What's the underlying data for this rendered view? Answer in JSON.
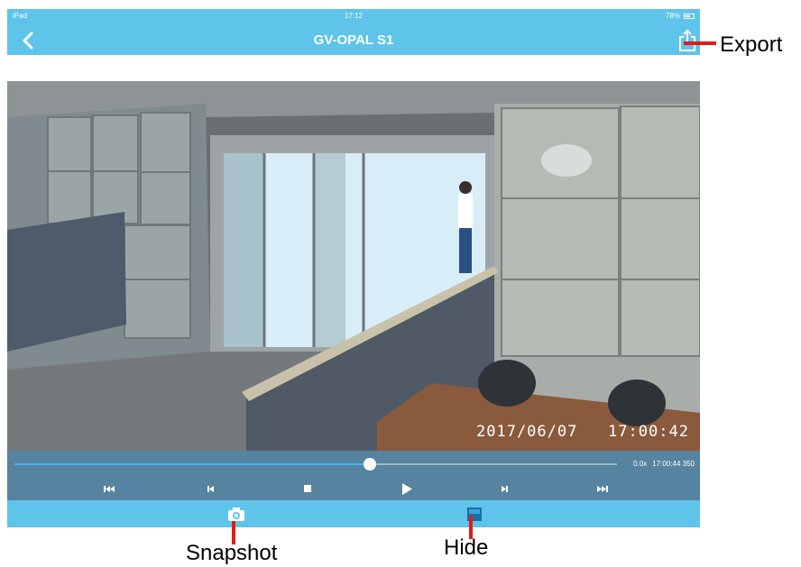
{
  "status_bar": {
    "carrier": "iPad",
    "time": "17:12",
    "battery": "78%"
  },
  "nav": {
    "title": "GV-OPAL S1"
  },
  "video": {
    "timestamp": "2017/06/07   17:00:42"
  },
  "seek": {
    "progress": 0.59,
    "speed": "0.0x",
    "time": "17:00:44 350"
  },
  "controls": [
    "skip-to-start-icon",
    "previous-frame-icon",
    "stop-icon",
    "play-icon",
    "next-frame-icon",
    "skip-to-end-icon"
  ],
  "annotations": {
    "export": "Export",
    "snapshot": "Snapshot",
    "hide": "Hide"
  },
  "colors": {
    "header": "#5ec4ea",
    "controls_bg": "#56839f",
    "seek_fill": "#3fb8ee",
    "pointer": "#e41b17"
  }
}
